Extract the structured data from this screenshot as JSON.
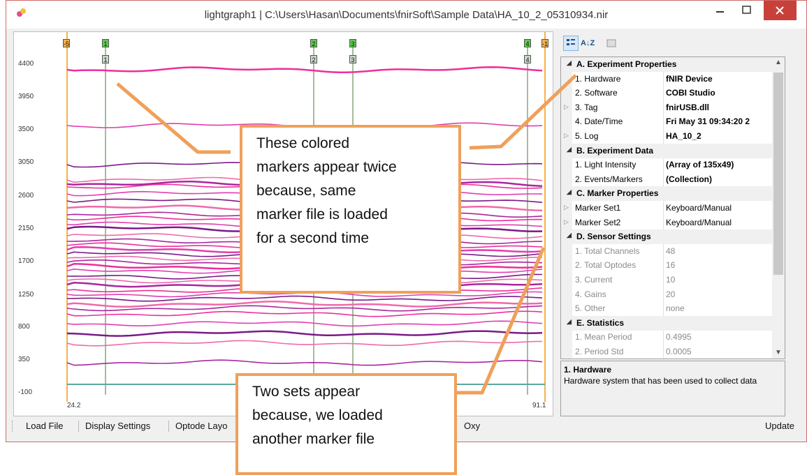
{
  "window": {
    "title": "lightgraph1 | C:\\Users\\Hasan\\Documents\\fnirSoft\\Sample Data\\HA_10_2_05310934.nir",
    "close_glyph": "✕",
    "min_glyph": "—",
    "max_glyph": "☐"
  },
  "plot": {
    "y_ticks": [
      "4400",
      "3950",
      "3500",
      "3050",
      "2600",
      "2150",
      "1700",
      "1250",
      "800",
      "350",
      "-100"
    ],
    "x_start": "24.2",
    "x_end": "91.1",
    "top_markers": [
      "-5",
      "1",
      "2",
      "3",
      "4",
      "-1"
    ],
    "second_markers": [
      "1",
      "2",
      "3",
      "4"
    ]
  },
  "toolbar": {
    "items": [
      "Load File",
      "Display Settings",
      "Optode Layo",
      "Oxy"
    ],
    "update_label": "Update"
  },
  "propgrid": {
    "buttons": [
      "categorized-icon",
      "alphabetical-icon",
      "property-pages-icon"
    ],
    "alpha_label": "A↓Z",
    "rows": [
      {
        "type": "cat",
        "label": "A. Experiment Properties"
      },
      {
        "type": "prop",
        "name": "1. Hardware",
        "value": "fNIR Device",
        "bold": true,
        "exp": false
      },
      {
        "type": "prop",
        "name": "2. Software",
        "value": "COBI Studio",
        "bold": true,
        "exp": false
      },
      {
        "type": "prop",
        "name": "3. Tag",
        "value": "fnirUSB.dll",
        "bold": true,
        "exp": true
      },
      {
        "type": "prop",
        "name": "4. Date/Time",
        "value": "Fri May 31 09:34:20 2",
        "bold": true,
        "exp": false
      },
      {
        "type": "prop",
        "name": "5. Log",
        "value": "HA_10_2",
        "bold": true,
        "exp": true
      },
      {
        "type": "cat",
        "label": "B. Experiment Data"
      },
      {
        "type": "prop",
        "name": "1. Light Intensity",
        "value": "(Array of 135x49)",
        "bold": true,
        "exp": false
      },
      {
        "type": "prop",
        "name": "2. Events/Markers",
        "value": "(Collection)",
        "bold": true,
        "exp": false
      },
      {
        "type": "cat",
        "label": "C. Marker Properties"
      },
      {
        "type": "prop",
        "name": "Marker Set1",
        "value": "Keyboard/Manual",
        "bold": false,
        "exp": true
      },
      {
        "type": "prop",
        "name": "Marker Set2",
        "value": "Keyboard/Manual",
        "bold": false,
        "exp": true
      },
      {
        "type": "cat",
        "label": "D. Sensor Settings"
      },
      {
        "type": "prop",
        "name": "1. Total Channels",
        "value": "48",
        "grey": true,
        "exp": false
      },
      {
        "type": "prop",
        "name": "2. Total Optodes",
        "value": "16",
        "grey": true,
        "exp": false
      },
      {
        "type": "prop",
        "name": "3. Current",
        "value": "10",
        "grey": true,
        "exp": false
      },
      {
        "type": "prop",
        "name": "4. Gains",
        "value": "20",
        "grey": true,
        "exp": false
      },
      {
        "type": "prop",
        "name": "5. Other",
        "value": "none",
        "grey": true,
        "exp": false
      },
      {
        "type": "cat",
        "label": "E. Statistics"
      },
      {
        "type": "prop",
        "name": "1. Mean Period",
        "value": "0.4995",
        "grey": true,
        "exp": false
      },
      {
        "type": "prop",
        "name": "2. Period Std",
        "value": "0.0005",
        "grey": true,
        "exp": false
      }
    ],
    "desc_title": "1. Hardware",
    "desc_text": "Hardware system that has been used to collect data"
  },
  "callouts": {
    "top": [
      "These colored",
      "markers appear twice",
      "because, same",
      "marker file is loaded",
      "for a second time"
    ],
    "bottom": [
      "Two sets appear",
      "because, we loaded",
      "another marker file"
    ]
  },
  "colors": {
    "accent_orange": "#f0a05a",
    "pink": "#ee2e9a",
    "magenta": "#e03fb0",
    "purple": "#7a1a88",
    "close_red": "#c7413a",
    "marker_green": "#5ccc4c"
  }
}
